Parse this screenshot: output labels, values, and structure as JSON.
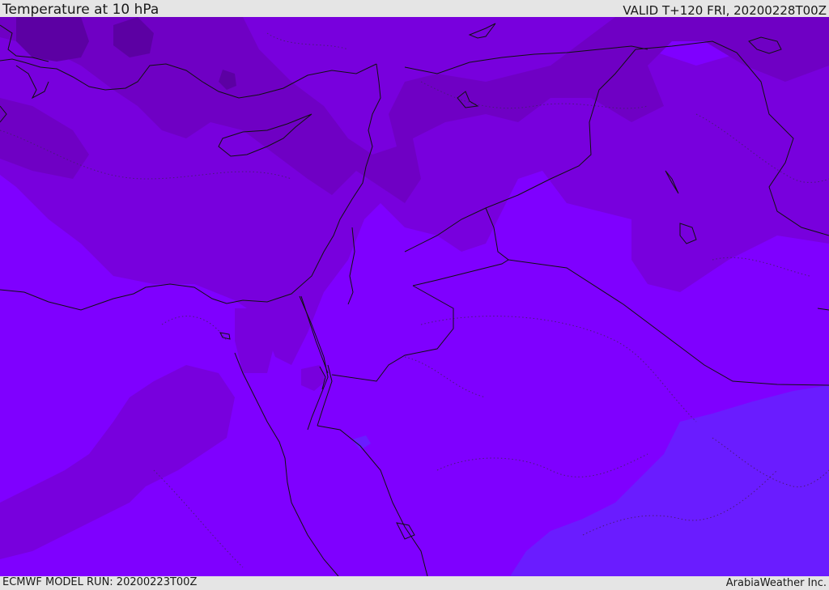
{
  "header": {
    "title": "Temperature at 10 hPa",
    "valid": "VALID T+120 FRI, 20200228T00Z"
  },
  "footer": {
    "model_run": "ECMWF MODEL RUN: 20200223T00Z",
    "credit": "ArabiaWeather Inc."
  },
  "colors": {
    "coldest": "#5c00a3",
    "colder": "#6f00c4",
    "cold": "#7800dd",
    "base": "#7f00ff",
    "warm": "#6a1cff"
  }
}
